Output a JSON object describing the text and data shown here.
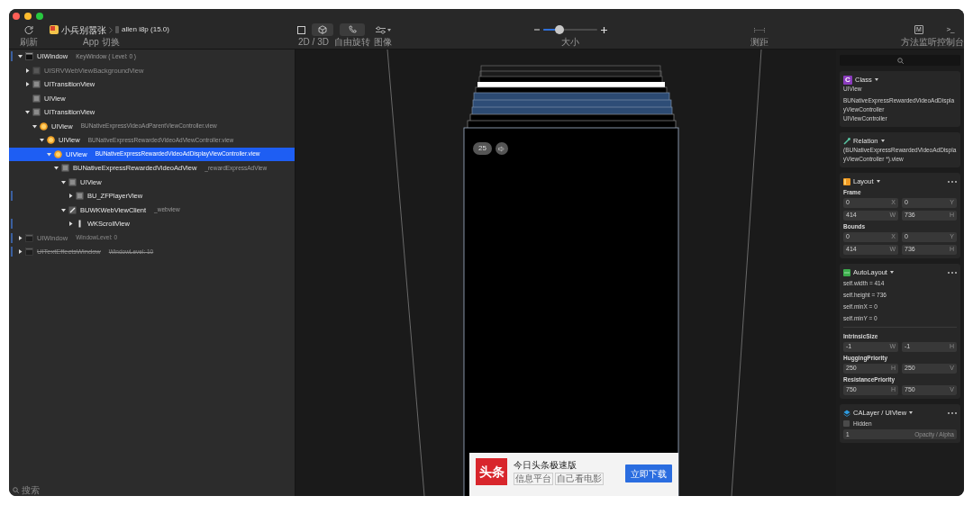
{
  "toolbar": {
    "refresh": {
      "label": "刷新"
    },
    "app_switcher": {
      "app": "小兵别嚣张",
      "device": "allen i8p (15.0)",
      "label": "App 切换"
    },
    "view_mode": {
      "label": "2D / 3D",
      "options": [
        {
          "kind": "flat",
          "selected": false
        },
        {
          "kind": "cube",
          "selected": true
        }
      ]
    },
    "free_rotation": {
      "on": true,
      "label": "自由旋转"
    },
    "image": {
      "label": "图像"
    },
    "size": {
      "level": 0.3,
      "label": "大小"
    },
    "measure": {
      "label": "测距"
    },
    "method_trace": {
      "icon_text": "M",
      "label": "方法监听"
    },
    "console": {
      "icon_text": ">_",
      "label": "控制台"
    }
  },
  "hierarchy": {
    "items": [
      {
        "name": "UIWindow",
        "detail": "KeyWindow ( Level: 0 )",
        "kind": "window",
        "expanded": true,
        "selected": false,
        "marked": true,
        "children": [
          {
            "name": "UISRVWebViewBackgroundView",
            "kind": "view",
            "expanded": false,
            "selected": false,
            "dimmed": true
          },
          {
            "name": "UITransitionView",
            "kind": "view",
            "expanded": false,
            "selected": false
          },
          {
            "name": "UIView",
            "kind": "view",
            "selected": false
          },
          {
            "name": "UITransitionView",
            "kind": "view",
            "expanded": true,
            "selected": false,
            "children": [
              {
                "name": "UIView",
                "detail": "BUNativeExpressVideoAdParentViewController.view",
                "kind": "controller",
                "expanded": true,
                "selected": false,
                "children": [
                  {
                    "name": "UIView",
                    "detail": "BUNativeExpressRewardedVideoAdViewController.view",
                    "kind": "controller",
                    "expanded": true,
                    "selected": false,
                    "children": [
                      {
                        "name": "UIView",
                        "detail": "BUNativeExpressRewardedVideoAdDisplayViewController.view",
                        "kind": "controller",
                        "expanded": true,
                        "selected": true,
                        "children": [
                          {
                            "name": "BUNativeExpressRewardedVideoAdView",
                            "detail": "_rewardExpressAdView",
                            "kind": "view",
                            "expanded": true,
                            "selected": false,
                            "children": [
                              {
                                "name": "UIView",
                                "kind": "view",
                                "expanded": true,
                                "selected": false,
                                "children": [
                                  {
                                    "name": "BU_ZFPlayerView",
                                    "kind": "view",
                                    "expanded": false,
                                    "selected": false,
                                    "marked": true
                                  }
                                ]
                              },
                              {
                                "name": "BUWKWebViewClient",
                                "detail": "_webview",
                                "kind": "webview",
                                "expanded": true,
                                "selected": false,
                                "children": [
                                  {
                                    "name": "WKScrollView",
                                    "kind": "scroll",
                                    "expanded": false,
                                    "selected": false,
                                    "marked": true
                                  }
                                ]
                              }
                            ]
                          }
                        ]
                      }
                    ]
                  }
                ]
              }
            ]
          }
        ]
      },
      {
        "name": "UIWindow",
        "detail": "WindowLevel: 0",
        "kind": "window",
        "expanded": false,
        "selected": false,
        "dimmed": true,
        "marked": true
      },
      {
        "name": "UITextEffectsWindow",
        "detail": "WindowLevel: 10",
        "kind": "window",
        "expanded": false,
        "selected": false,
        "dimmed": true,
        "struck": true,
        "marked": true
      }
    ],
    "search": {
      "placeholder": "搜索"
    }
  },
  "preview": {
    "countdown": "25",
    "ad": {
      "logo": "头条",
      "title": "今日头条极速版",
      "tags": [
        "信息平台",
        "自己看电影"
      ],
      "button": "立即下载"
    }
  },
  "inspector": {
    "class": {
      "icon_text": "C",
      "title": "Class",
      "name": "UIView",
      "lines": [
        "BUNativeExpressRewardedVideoAdDisplayViewController",
        "UIViewController"
      ]
    },
    "relation": {
      "title": "Relation",
      "text": "(BUNativeExpressRewardedVideoAdDisplayViewController *).view"
    },
    "layout": {
      "title": "Layout",
      "groups": [
        {
          "title": "Frame",
          "fields": [
            {
              "value": "0",
              "unit": "X"
            },
            {
              "value": "0",
              "unit": "Y"
            },
            {
              "value": "414",
              "unit": "W"
            },
            {
              "value": "736",
              "unit": "H"
            }
          ]
        },
        {
          "title": "Bounds",
          "fields": [
            {
              "value": "0",
              "unit": "X"
            },
            {
              "value": "0",
              "unit": "Y"
            },
            {
              "value": "414",
              "unit": "W"
            },
            {
              "value": "736",
              "unit": "H"
            }
          ]
        }
      ]
    },
    "autolayout": {
      "title": "AutoLayout",
      "constraints": [
        "self.width = 414",
        "self.height = 736",
        "self.minX = 0",
        "self.minY = 0"
      ],
      "groups": [
        {
          "title": "IntrinsicSize",
          "fields": [
            {
              "value": "-1",
              "unit": "W"
            },
            {
              "value": "-1",
              "unit": "H"
            }
          ]
        },
        {
          "title": "HuggingPriority",
          "fields": [
            {
              "value": "250",
              "unit": "H"
            },
            {
              "value": "250",
              "unit": "V"
            }
          ]
        },
        {
          "title": "ResistancePriority",
          "fields": [
            {
              "value": "750",
              "unit": "H"
            },
            {
              "value": "750",
              "unit": "V"
            }
          ]
        }
      ]
    },
    "calayer": {
      "title": "CALayer / UIView",
      "hidden": {
        "label": "Hidden",
        "checked": false
      },
      "opacity": {
        "value": "1",
        "label": "Opacity / Alpha"
      }
    }
  }
}
